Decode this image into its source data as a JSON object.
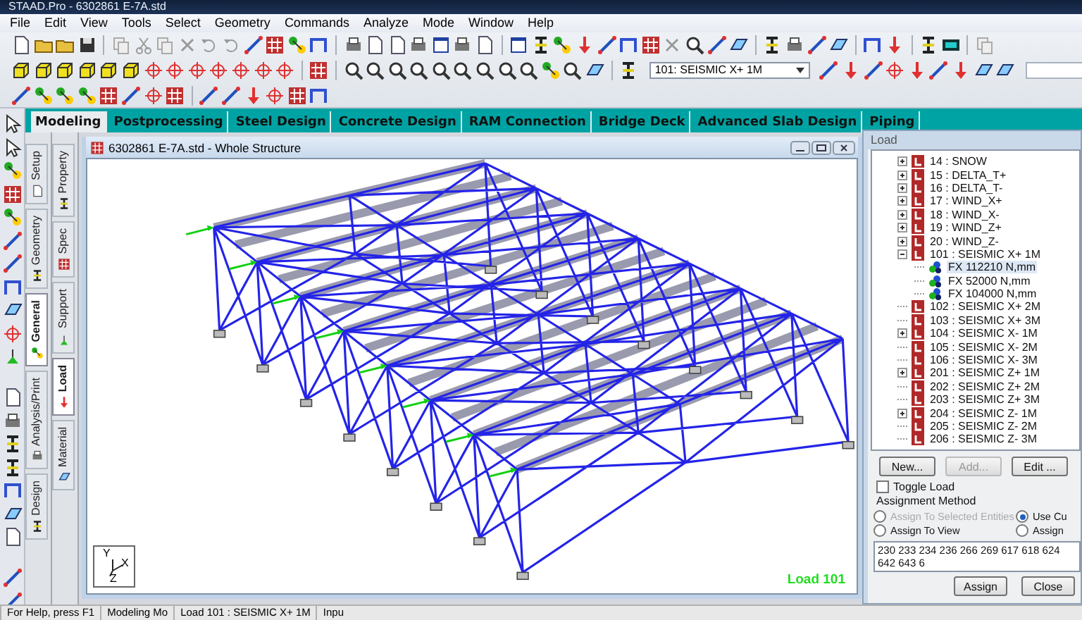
{
  "window": {
    "title": "STAAD.Pro - 6302861 E-7A.std"
  },
  "menu": [
    "File",
    "Edit",
    "View",
    "Tools",
    "Select",
    "Geometry",
    "Commands",
    "Analyze",
    "Mode",
    "Window",
    "Help"
  ],
  "toolbar": {
    "load_case_dropdown": "101: SEISMIC X+ 1M"
  },
  "tabs": [
    {
      "label": "Modeling",
      "selected": true
    },
    {
      "label": "Postprocessing",
      "selected": false
    },
    {
      "label": "Steel Design",
      "selected": false
    },
    {
      "label": "Concrete Design",
      "selected": false
    },
    {
      "label": "RAM Connection",
      "selected": false
    },
    {
      "label": "Bridge Deck",
      "selected": false
    },
    {
      "label": "Advanced Slab Design",
      "selected": false
    },
    {
      "label": "Piping",
      "selected": false
    }
  ],
  "page_tabs": [
    {
      "label": "Setup",
      "selected": false
    },
    {
      "label": "Geometry",
      "selected": false
    },
    {
      "label": "General",
      "selected": true
    },
    {
      "label": "Analysis/Print",
      "selected": false
    },
    {
      "label": "Design",
      "selected": false
    }
  ],
  "subpage_tabs": [
    {
      "label": "Property",
      "selected": false
    },
    {
      "label": "Spec",
      "selected": false
    },
    {
      "label": "Support",
      "selected": false
    },
    {
      "label": "Load",
      "selected": true
    },
    {
      "label": "Material",
      "selected": false
    }
  ],
  "document": {
    "title": "6302861 E-7A.std - Whole Structure",
    "load_label": "Load 101",
    "axis_labels": [
      "Y",
      "X",
      "Z"
    ]
  },
  "load_panel": {
    "title": "Load",
    "tree": [
      {
        "label": "14 : SNOW",
        "kind": "collapsed",
        "selected": false
      },
      {
        "label": "15 : DELTA_T+",
        "kind": "collapsed",
        "selected": false
      },
      {
        "label": "16 : DELTA_T-",
        "kind": "collapsed",
        "selected": false
      },
      {
        "label": "17 : WIND_X+",
        "kind": "collapsed",
        "selected": false
      },
      {
        "label": "18 : WIND_X-",
        "kind": "collapsed",
        "selected": false
      },
      {
        "label": "19 : WIND_Z+",
        "kind": "collapsed",
        "selected": false
      },
      {
        "label": "20 : WIND_Z-",
        "kind": "collapsed",
        "selected": false
      },
      {
        "label": "101 : SEISMIC X+ 1M",
        "kind": "expanded",
        "selected": false,
        "children": [
          {
            "label": "FX 112210 N,mm",
            "kind": "leaf",
            "selected": true
          },
          {
            "label": "FX 52000 N,mm",
            "kind": "leaf",
            "selected": false
          },
          {
            "label": "FX 104000 N,mm",
            "kind": "leaf",
            "selected": false
          }
        ]
      },
      {
        "label": "102 : SEISMIC X+ 2M",
        "kind": "leaf",
        "selected": false
      },
      {
        "label": "103 : SEISMIC X+ 3M",
        "kind": "leaf",
        "selected": false
      },
      {
        "label": "104 : SEISMIC X- 1M",
        "kind": "collapsed",
        "selected": false
      },
      {
        "label": "105 : SEISMIC X- 2M",
        "kind": "leaf",
        "selected": false
      },
      {
        "label": "106 : SEISMIC X- 3M",
        "kind": "leaf",
        "selected": false
      },
      {
        "label": "201 : SEISMIC Z+ 1M",
        "kind": "collapsed",
        "selected": false
      },
      {
        "label": "202 : SEISMIC Z+ 2M",
        "kind": "leaf",
        "selected": false
      },
      {
        "label": "203 : SEISMIC Z+ 3M",
        "kind": "leaf",
        "selected": false
      },
      {
        "label": "204 : SEISMIC Z- 1M",
        "kind": "collapsed",
        "selected": false
      },
      {
        "label": "205 : SEISMIC Z- 2M",
        "kind": "leaf",
        "selected": false
      },
      {
        "label": "206 : SEISMIC Z- 3M",
        "kind": "leaf",
        "selected": false
      }
    ],
    "buttons": [
      {
        "label": "New...",
        "disabled": false
      },
      {
        "label": "Add...",
        "disabled": true
      },
      {
        "label": "Edit ...",
        "disabled": false
      }
    ],
    "toggle_load": {
      "label": "Toggle Load",
      "checked": false
    },
    "assignment_method": {
      "label": "Assignment Method",
      "options": [
        {
          "label": "Assign To Selected Entities",
          "selected": false,
          "disabled": true
        },
        {
          "label": "Use Cu",
          "selected": true,
          "disabled": false
        },
        {
          "label": "Assign To View",
          "selected": false,
          "disabled": false
        },
        {
          "label": "Assign",
          "selected": false,
          "disabled": false
        }
      ]
    },
    "entity_list": "230 233 234 236 266 269 617 618 624 642 643 6",
    "action_buttons": [
      "Assign",
      "Close"
    ]
  },
  "status_bar": [
    "For Help, press F1",
    "Modeling Mo",
    "Load 101 : SEISMIC X+ 1M",
    "Inpu"
  ]
}
